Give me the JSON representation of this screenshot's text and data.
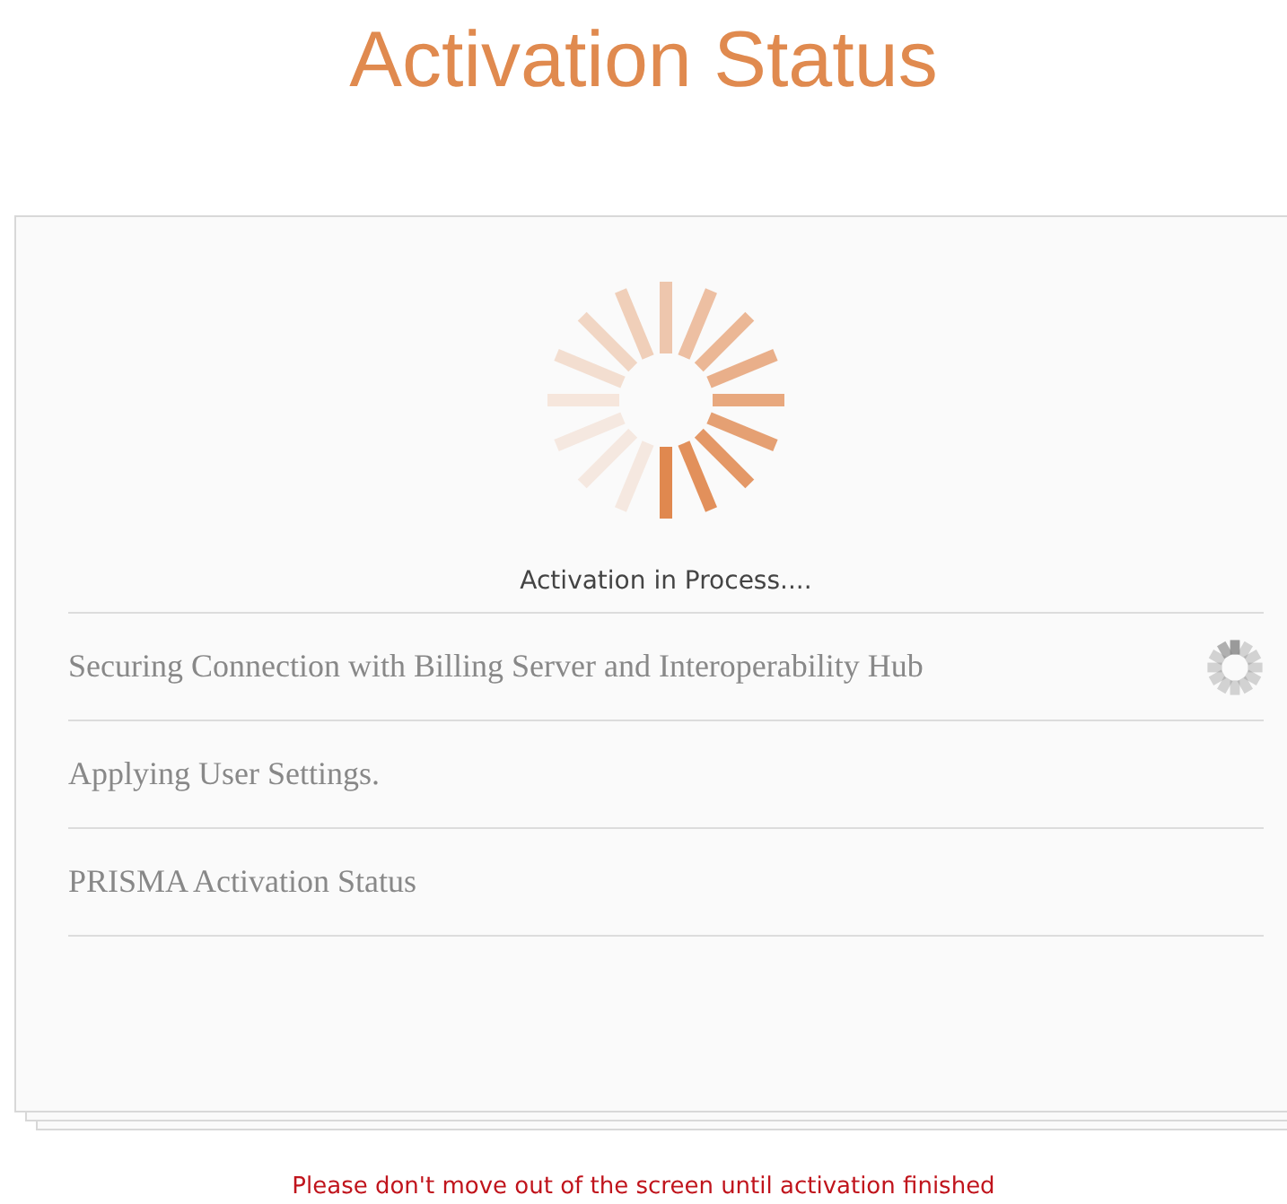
{
  "title": "Activation Status",
  "progress": {
    "message": "Activation in Process...."
  },
  "steps": [
    {
      "label": "Securing Connection with Billing Server and Interoperability Hub",
      "in_progress": true
    },
    {
      "label": "Applying User Settings.",
      "in_progress": false
    },
    {
      "label": "PRISMA Activation Status",
      "in_progress": false
    }
  ],
  "warning": "Please don't move out of the screen until activation finished"
}
